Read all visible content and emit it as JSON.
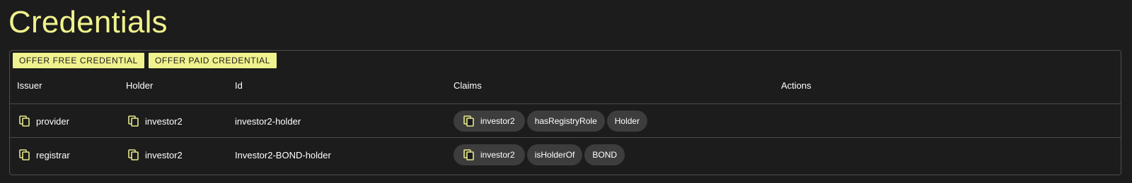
{
  "page": {
    "title": "Credentials"
  },
  "toolbar": {
    "offer_free_label": "OFFER FREE CREDENTIAL",
    "offer_paid_label": "OFFER PAID CREDENTIAL"
  },
  "table": {
    "columns": [
      "Issuer",
      "Holder",
      "Id",
      "Claims",
      "Actions"
    ],
    "rows": [
      {
        "issuer": "provider",
        "holder": "investor2",
        "id": "investor2-holder",
        "claims": [
          "investor2",
          "hasRegistryRole",
          "Holder"
        ]
      },
      {
        "issuer": "registrar",
        "holder": "investor2",
        "id": "Investor2-BOND-holder",
        "claims": [
          "investor2",
          "isHolderOf",
          "BOND"
        ]
      }
    ]
  },
  "colors": {
    "accent": "#f0f28d",
    "background": "#1c1c1c",
    "chip": "#3d3d3d",
    "border": "#4e4e4e"
  },
  "icons": {
    "copy": "copy-icon"
  }
}
